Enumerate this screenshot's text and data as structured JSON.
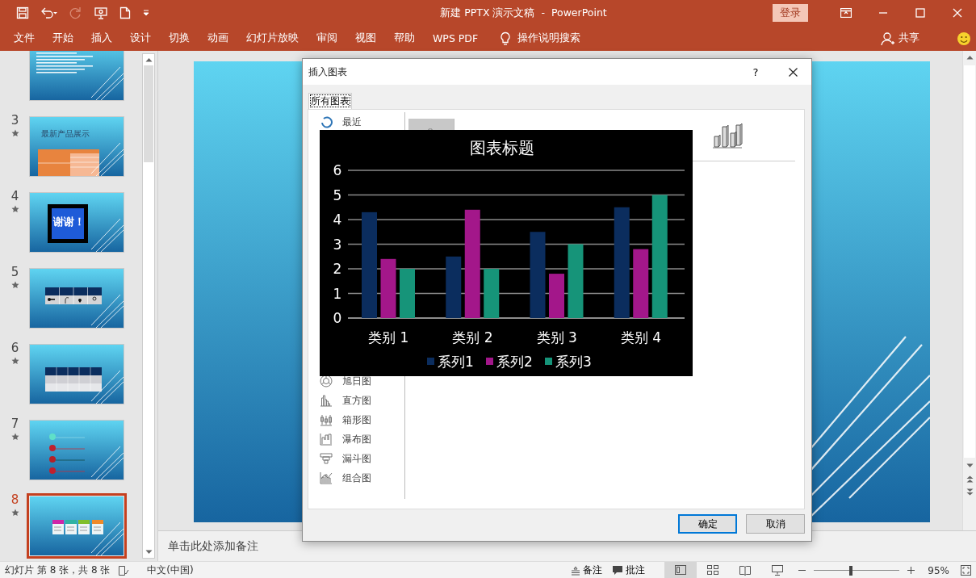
{
  "window": {
    "title": "新建 PPTX 演示文稿  -  PowerPoint",
    "login": "登录"
  },
  "ribbon": {
    "tabs": [
      {
        "label": "文件"
      },
      {
        "label": "开始"
      },
      {
        "label": "插入"
      },
      {
        "label": "设计"
      },
      {
        "label": "切换"
      },
      {
        "label": "动画"
      },
      {
        "label": "幻灯片放映"
      },
      {
        "label": "审阅"
      },
      {
        "label": "视图"
      },
      {
        "label": "帮助"
      },
      {
        "label": "WPS PDF"
      }
    ],
    "tell_me": "操作说明搜索",
    "share": "共享"
  },
  "slides": [
    {
      "kind": "text",
      "selected": false
    },
    {
      "number": "3",
      "kind": "title-table",
      "title": "最新产品展示",
      "selected": false
    },
    {
      "number": "4",
      "kind": "thanks",
      "title": "谢谢！",
      "selected": false
    },
    {
      "number": "5",
      "kind": "icon-table",
      "selected": false
    },
    {
      "number": "6",
      "kind": "table",
      "selected": false
    },
    {
      "number": "7",
      "kind": "numbered-list",
      "selected": false
    },
    {
      "number": "8",
      "kind": "cards",
      "selected": true
    }
  ],
  "notes_placeholder": "单击此处添加备注",
  "dialog": {
    "title": "插入图表",
    "help": "?",
    "tabs": [
      {
        "label": "所有图表",
        "selected": true
      }
    ],
    "chart_types": [
      {
        "label": "最近",
        "kind": "recent"
      },
      {
        "label": "旭日图",
        "kind": "sunburst"
      },
      {
        "label": "直方图",
        "kind": "histogram"
      },
      {
        "label": "箱形图",
        "kind": "box"
      },
      {
        "label": "瀑布图",
        "kind": "waterfall"
      },
      {
        "label": "漏斗图",
        "kind": "funnel"
      },
      {
        "label": "组合图",
        "kind": "combo"
      }
    ],
    "buttons": [
      {
        "label": "确定",
        "kind": "primary"
      },
      {
        "label": "取消",
        "kind": "secondary"
      }
    ],
    "preview": {
      "chart_data": {
        "type": "bar",
        "title": "图表标题",
        "categories": [
          "类别 1",
          "类别 2",
          "类别 3",
          "类别 4"
        ],
        "series": [
          {
            "name": "系列1",
            "color": "#0b2d5e",
            "values": [
              4.3,
              2.5,
              3.5,
              4.5
            ]
          },
          {
            "name": "系列2",
            "color": "#a3178a",
            "values": [
              2.4,
              4.4,
              1.8,
              2.8
            ]
          },
          {
            "name": "系列3",
            "color": "#169479",
            "values": [
              2,
              2,
              3,
              5
            ]
          }
        ],
        "ylim": [
          0,
          6
        ],
        "yticks": [
          0,
          1,
          2,
          3,
          4,
          5,
          6
        ],
        "grid": true,
        "legend": "bottom"
      }
    }
  },
  "status_bar": {
    "slide_info": "幻灯片 第 8 张，共 8 张",
    "language": "中文(中国)",
    "notes": "备注",
    "comments": "批注",
    "views": [
      {
        "kind": "normal",
        "selected": true
      },
      {
        "kind": "sorter",
        "selected": false
      },
      {
        "kind": "reading",
        "selected": false
      },
      {
        "kind": "show",
        "selected": false
      }
    ],
    "zoom": {
      "level": 0.43,
      "reading": "95%"
    }
  }
}
